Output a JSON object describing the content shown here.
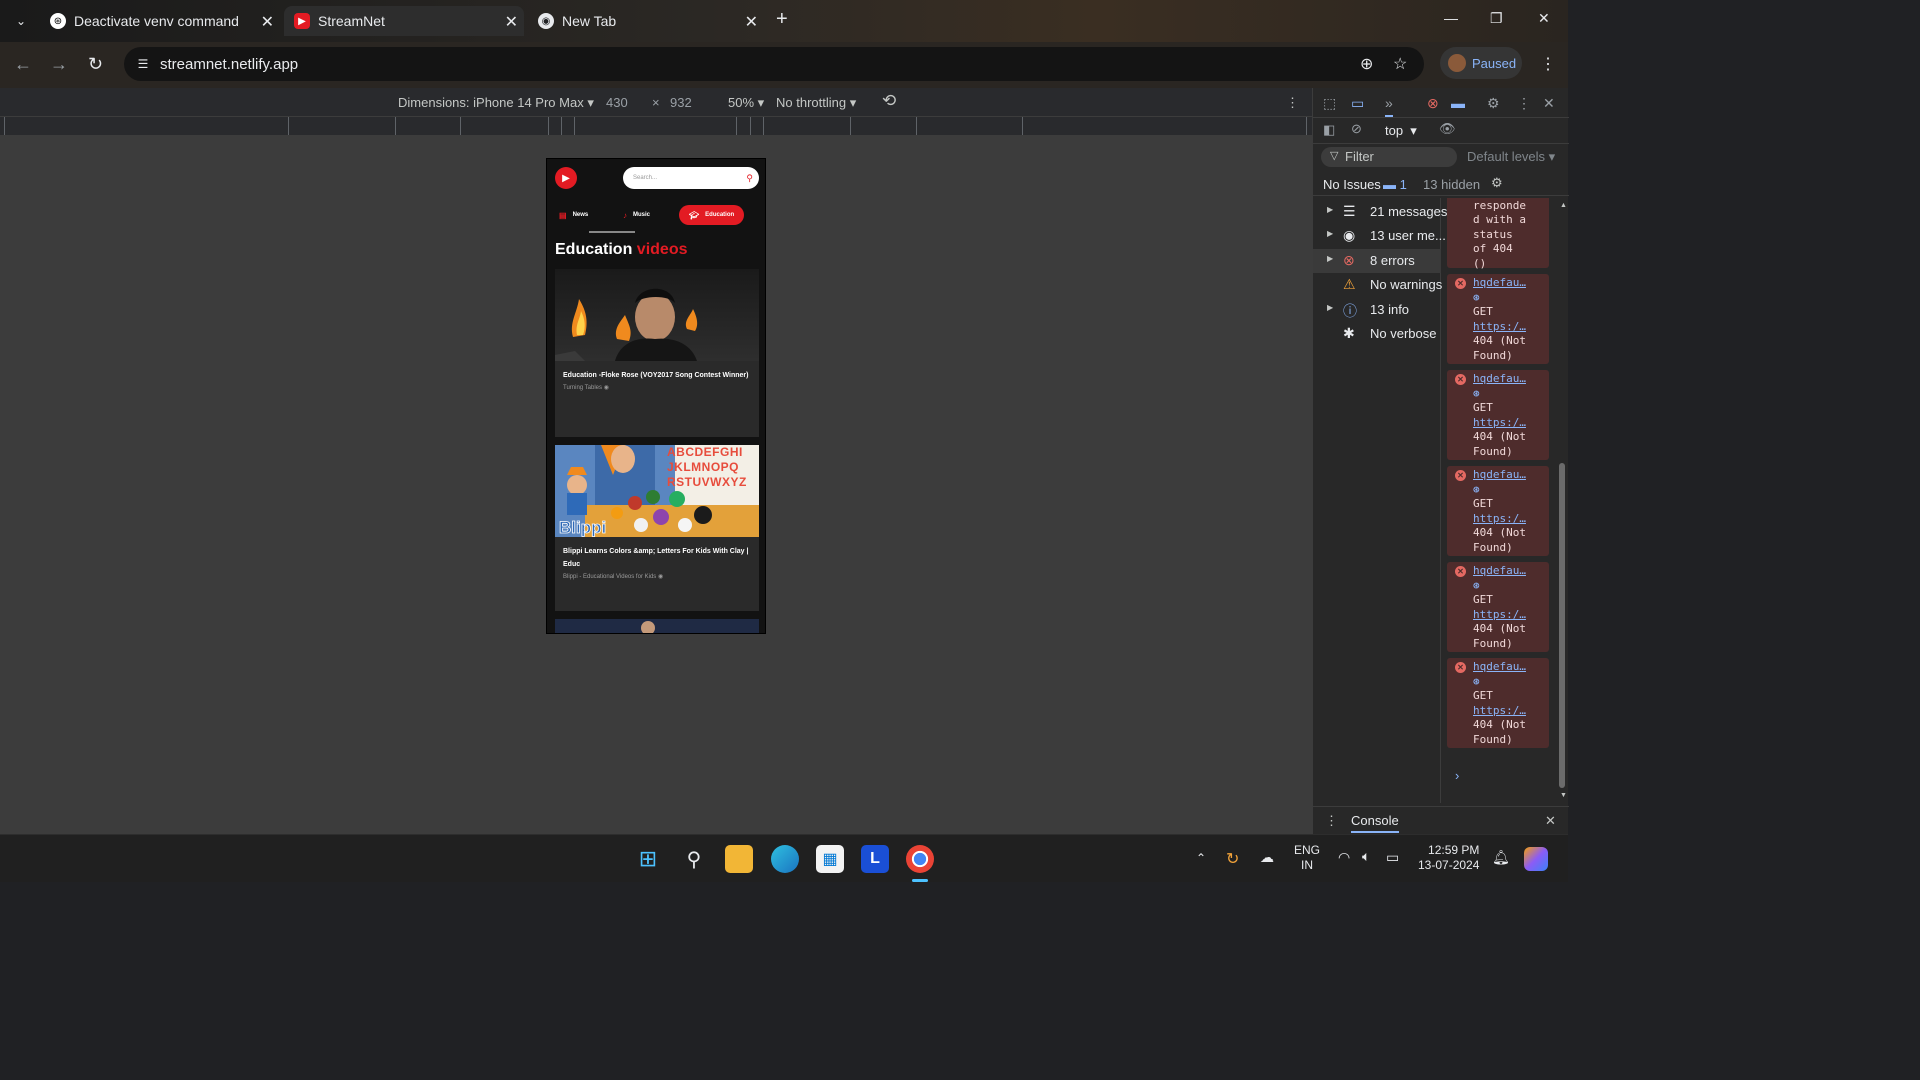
{
  "browser": {
    "tabs": [
      {
        "title": "Deactivate venv command",
        "icon": "chatgpt-icon"
      },
      {
        "title": "StreamNet",
        "icon": "youtube-icon"
      },
      {
        "title": "New Tab",
        "icon": "chrome-icon"
      }
    ],
    "url": "streamnet.netlify.app",
    "profile_status": "Paused"
  },
  "device_toolbar": {
    "dimensions": "Dimensions: iPhone 14 Pro Max",
    "width": "430",
    "height": "932",
    "zoom": "50%",
    "throttling": "No throttling"
  },
  "app": {
    "search_placeholder": "Search...",
    "chips": [
      "News",
      "Music",
      "Education"
    ],
    "heading_main": "Education",
    "heading_accent": "videos",
    "videos": [
      {
        "title": "Education -Floke Rose (VOY2017 Song Contest Winner)",
        "channel": "Turning Tables"
      },
      {
        "title": "Blippi Learns Colors &amp; Letters For Kids With Clay | Educ",
        "channel": "Blippi - Educational Videos for Kids"
      }
    ],
    "blippi_letters": "ABCDEFGHI\nJKLMNOPQ\nRSTUVWXYZ",
    "blippi_logo": "Blippi"
  },
  "devtools": {
    "context": "top",
    "filter_placeholder": "Filter",
    "default_levels": "Default levels",
    "issues_label": "No Issues",
    "issues_count": "1",
    "hidden": "13 hidden",
    "sidebar": [
      {
        "label": "21 messages",
        "icon": "list-icon",
        "expandable": true
      },
      {
        "label": "13 user me...",
        "icon": "user-icon",
        "expandable": true
      },
      {
        "label": "8 errors",
        "icon": "error-icon",
        "expandable": true
      },
      {
        "label": "No warnings",
        "icon": "warning-icon",
        "expandable": false
      },
      {
        "label": "13 info",
        "icon": "info-icon",
        "expandable": true
      },
      {
        "label": "No verbose",
        "icon": "bug-icon",
        "expandable": false
      }
    ],
    "first_message_tail": "ser-ver-\nresponde\nd with a\nstatus\nof 404\n()",
    "error_messages": [
      {
        "source": "hqdefau…",
        "method": "GET",
        "url": "https:/…",
        "status": "404 (Not",
        "status2": "Found)"
      },
      {
        "source": "hqdefau…",
        "method": "GET",
        "url": "https:/…",
        "status": "404 (Not",
        "status2": "Found)"
      },
      {
        "source": "hqdefau…",
        "method": "GET",
        "url": "https:/…",
        "status": "404 (Not",
        "status2": "Found)"
      },
      {
        "source": "hqdefau…",
        "method": "GET",
        "url": "https:/…",
        "status": "404 (Not",
        "status2": "Found)"
      },
      {
        "source": "hqdefau…",
        "method": "GET",
        "url": "https:/…",
        "status": "404 (Not",
        "status2": "Found)"
      }
    ],
    "drawer_tab": "Console"
  },
  "taskbar": {
    "lang": "ENG",
    "region": "IN",
    "time": "12:59 PM",
    "date": "13-07-2024"
  },
  "colors": {
    "accent": "#e31b23",
    "link": "#8ab4f8",
    "error_bg": "#4e2c2c"
  }
}
